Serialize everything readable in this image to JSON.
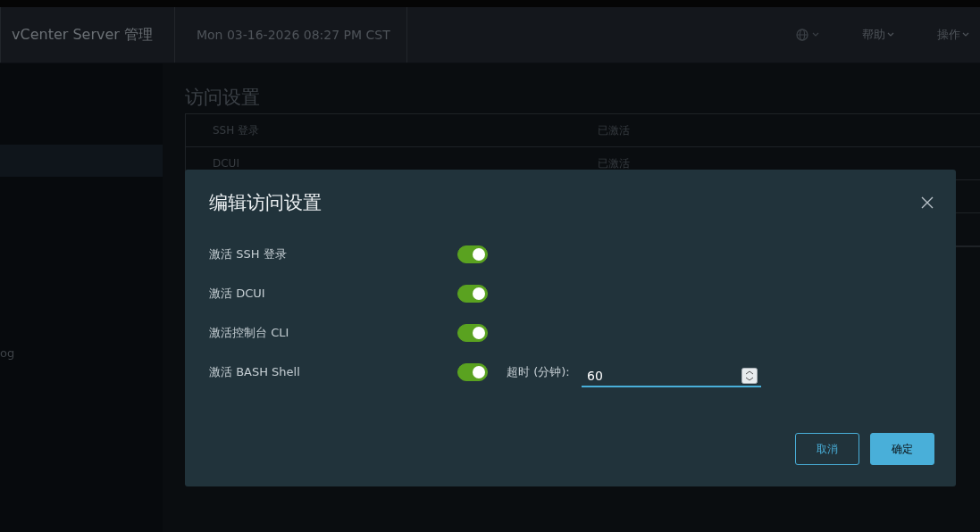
{
  "header": {
    "title": "vCenter Server 管理",
    "datetime": "Mon 03-16-2026 08:27 PM CST",
    "menus": [
      {
        "kind": "globe"
      },
      {
        "kind": "text",
        "label": "帮助"
      },
      {
        "kind": "text",
        "label": "操作"
      }
    ]
  },
  "sidebar": {
    "items": [
      {
        "selected": true
      },
      {
        "label": "og",
        "selected": false
      }
    ]
  },
  "page": {
    "title": "访问设置",
    "rows": [
      {
        "name": "SSH 登录",
        "value": "已激活"
      },
      {
        "name": "DCUI",
        "value": "已激活"
      },
      {},
      {}
    ]
  },
  "dialog": {
    "title": "编辑访问设置",
    "settings": [
      {
        "label": "激活 SSH 登录",
        "on": true
      },
      {
        "label": "激活 DCUI",
        "on": true
      },
      {
        "label": "激活控制台 CLI",
        "on": true
      },
      {
        "label": "激活 BASH Shell",
        "on": true,
        "timeout_label": "超时 (分钟):",
        "timeout_value": "60"
      }
    ],
    "buttons": [
      {
        "label": "取消",
        "kind": "secondary"
      },
      {
        "label": "确定",
        "kind": "primary"
      }
    ]
  }
}
